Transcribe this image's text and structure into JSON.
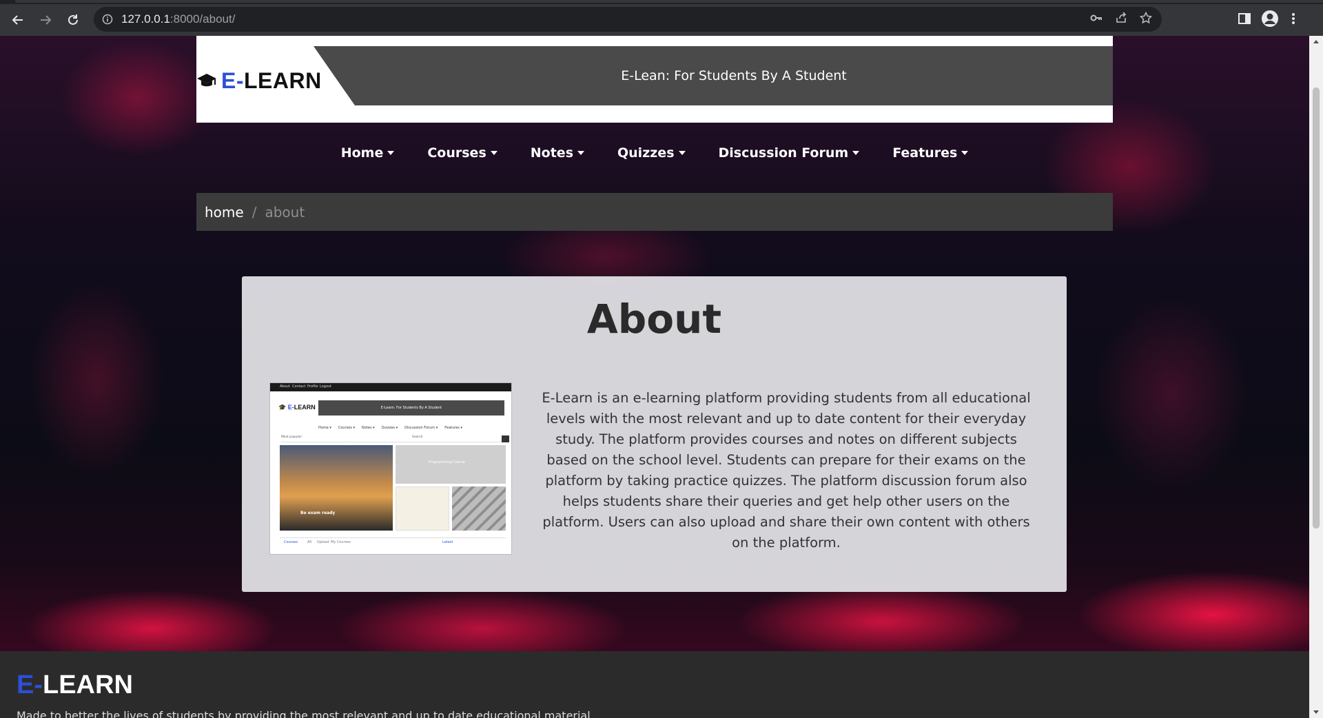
{
  "browser": {
    "url_host": "127.0.0.1",
    "url_path": ":8000/about/"
  },
  "header": {
    "logo_prefix": "E-",
    "logo_rest": "LEARN",
    "tagline": "E-Lean: For Students By A Student"
  },
  "nav": {
    "items": [
      {
        "label": "Home"
      },
      {
        "label": "Courses"
      },
      {
        "label": "Notes"
      },
      {
        "label": "Quizzes"
      },
      {
        "label": "Discussion Forum"
      },
      {
        "label": "Features"
      }
    ]
  },
  "breadcrumb": {
    "home": "home",
    "separator": "/",
    "current": "about"
  },
  "about": {
    "title": "About",
    "text": "E-Learn is an e-learning platform providing students from all educational levels with the most relevant and up to date content for their everyday study. The platform provides courses and notes on different subjects based on the school level. Students can prepare for their exams on the platform by taking practice quizzes. The platform discussion forum also helps students share their queries and get help other users on the platform. Users can also upload and share their own content with others on the platform."
  },
  "thumbnail": {
    "top_links": [
      "About",
      "Contact",
      "Profile",
      "Logout"
    ],
    "logo_prefix": "E-",
    "logo_rest": "LEARN",
    "tagline": "E-Learn: For Students By A Student",
    "nav": [
      "Home ▾",
      "Courses ▾",
      "Notes ▾",
      "Quizzes ▾",
      "Discussion Forum ▾",
      "Features ▾"
    ],
    "search_label": "Most popular:",
    "search_placeholder": "Search",
    "slide_caption": "Be exam ready",
    "card_label": "Programming Course",
    "tabs": [
      "Courses",
      "All",
      "Upload",
      "My Courses"
    ],
    "latest": "Latest"
  },
  "footer": {
    "logo_prefix": "E-",
    "logo_rest": "LEARN",
    "tagline": "Made to better the lives of students by providing the most relevant and up to date educational material"
  },
  "colors": {
    "accent": "#2d4fd8",
    "banner": "#4a4a4a",
    "footer": "#2b2b2b"
  }
}
